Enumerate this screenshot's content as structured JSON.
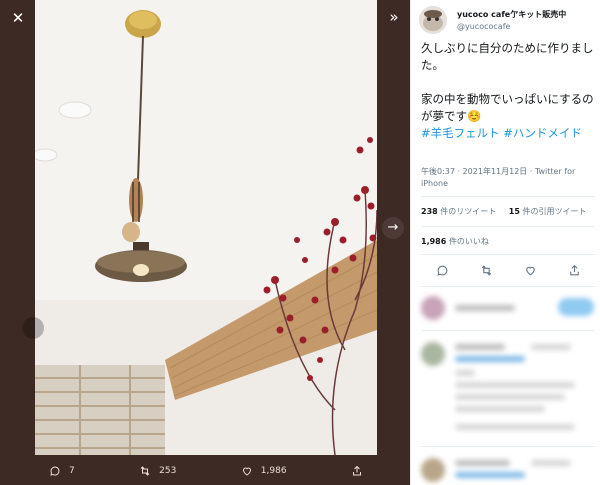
{
  "viewer": {
    "close_icon": "close-icon",
    "collapse_icon": "double-chevron-right-icon",
    "next_icon": "arrow-right-icon",
    "actions": {
      "reply_count": "7",
      "retweet_count": "253",
      "like_count": "1,986"
    }
  },
  "tweet": {
    "display_name": "yucoco cafe亇キット販売中",
    "handle": "@yucococafe",
    "text_line1": "久しぶりに自分のために作りました。",
    "text_line2": "家の中を動物でいっぱいにするのが夢です☺️",
    "hashtags": "#羊毛フェルト #ハンドメイド",
    "meta": "午後0:37 · 2021年11月12日 · Twitter for iPhone",
    "retweets_num": "238",
    "retweets_label": "件のリツイート",
    "quotes_num": "15",
    "quotes_label": "件の引用ツイート",
    "likes_num": "1,986",
    "likes_label": "件のいいね"
  },
  "colors": {
    "viewer_bg": "#3e2a25",
    "link": "#1b95e0"
  }
}
